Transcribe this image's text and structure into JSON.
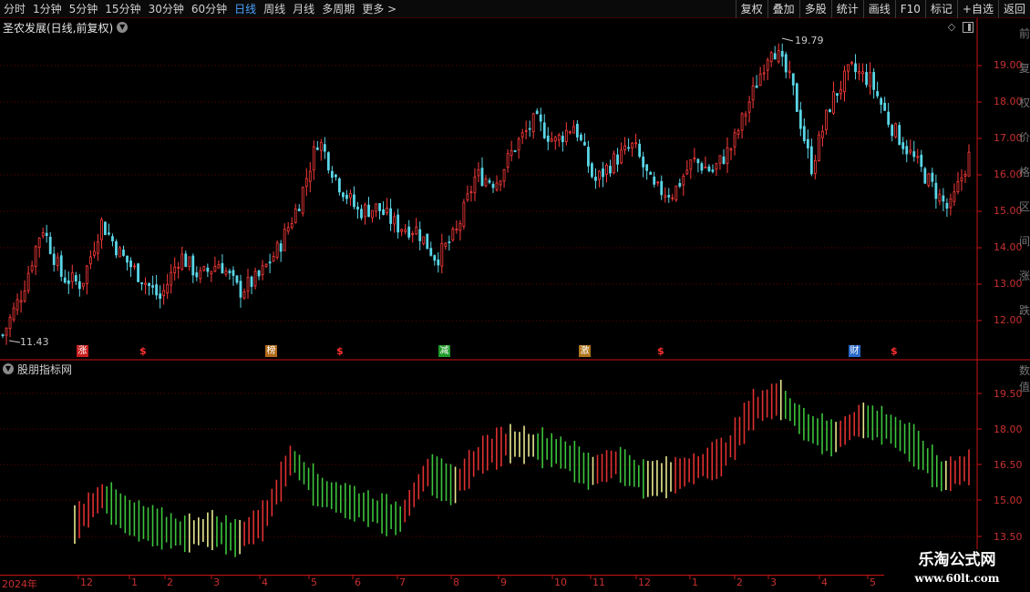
{
  "toolbar": {
    "periods": [
      "分时",
      "1分钟",
      "5分钟",
      "15分钟",
      "30分钟",
      "60分钟",
      "日线",
      "周线",
      "月线",
      "多周期",
      "更多"
    ],
    "active_period": "日线",
    "more_arrow": ">",
    "tools": [
      "复权",
      "叠加",
      "多股",
      "统计",
      "画线",
      "F10",
      "标记",
      "+自选",
      "返回"
    ]
  },
  "main_panel": {
    "title": "圣农发展(日线,前复权)",
    "high_label": "19.79",
    "low_label": "11.43",
    "y_ticks": [
      "19.00",
      "18.00",
      "17.00",
      "16.00",
      "15.00",
      "14.00",
      "13.00",
      "12.00"
    ],
    "side_chars": [
      "前",
      "复",
      "权",
      "价",
      "格",
      "区",
      "间",
      "涨",
      "跌"
    ],
    "signals": [
      {
        "text": "涨",
        "bg": "#c81e1e"
      },
      {
        "text": "榜",
        "bg": "#b06a1a"
      },
      {
        "text": "减",
        "bg": "#1e9a2a"
      },
      {
        "text": "激",
        "bg": "#b0761a"
      },
      {
        "text": "财",
        "bg": "#2a6ac8"
      }
    ],
    "dollar": "$"
  },
  "sub_panel": {
    "title": "股朋指标网",
    "y_ticks": [
      "19.50",
      "18.00",
      "16.50",
      "15.00",
      "13.50"
    ],
    "side_chars": [
      "数",
      "值"
    ]
  },
  "date_axis": {
    "labels": [
      "2024年",
      "12",
      "1",
      "2",
      "3",
      "4",
      "5",
      "6",
      "7",
      "8",
      "9",
      "10",
      "11",
      "12",
      "1",
      "2",
      "3",
      "4",
      "5"
    ]
  },
  "watermark": {
    "title": "乐淘公式网",
    "url": "www.60lt.com"
  },
  "colors": {
    "up": "#ff3b3b",
    "down": "#5ad6e8",
    "grid": "#6a0000",
    "axis": "#c81414",
    "bar_yellow": "#e8e890",
    "bar_green": "#3cc43c",
    "bar_red": "#e03030"
  },
  "chart_data": {
    "type": "candlestick",
    "y_range": [
      11.0,
      20.0
    ],
    "close_path": [
      11.6,
      12.8,
      14.6,
      13.2,
      13.0,
      14.7,
      13.8,
      13.2,
      12.6,
      13.8,
      13.2,
      13.6,
      12.8,
      13.2,
      14.0,
      15.2,
      17.0,
      15.8,
      15.0,
      15.1,
      14.6,
      14.5,
      13.7,
      14.4,
      16.0,
      15.8,
      16.8,
      17.5,
      16.9,
      17.4,
      15.8,
      16.4,
      16.8,
      15.6,
      15.5,
      16.4,
      16.1,
      16.8,
      18.2,
      19.6,
      18.5,
      16.2,
      18.0,
      18.9,
      18.6,
      17.4,
      16.6,
      15.8,
      15.0,
      16.5
    ],
    "indicator": {
      "y_range": [
        13.0,
        20.5
      ],
      "center_path": [
        14.0,
        15.2,
        14.3,
        13.9,
        13.6,
        13.8,
        13.4,
        14.2,
        16.8,
        15.4,
        15.0,
        14.6,
        14.2,
        16.2,
        15.6,
        16.9,
        17.4,
        17.3,
        17.0,
        16.2,
        16.6,
        15.9,
        16.0,
        16.4,
        16.9,
        18.8,
        19.3,
        18.1,
        17.6,
        18.4,
        18.1,
        17.3,
        16.0,
        16.4
      ]
    }
  }
}
